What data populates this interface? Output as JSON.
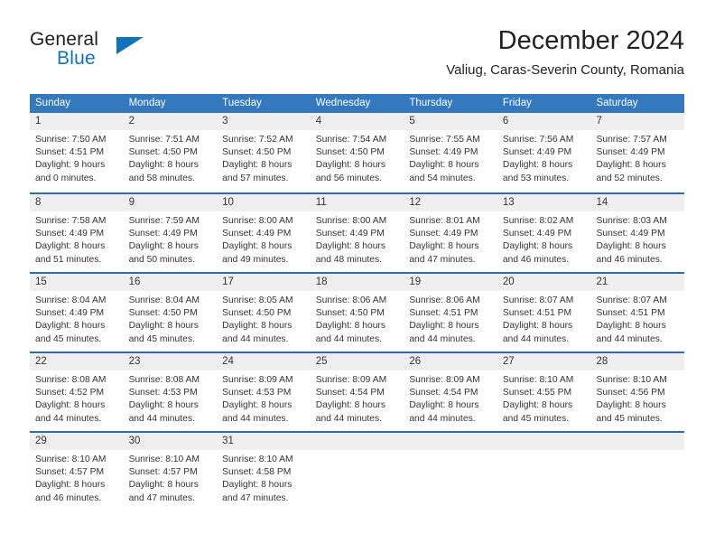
{
  "brand": {
    "name_top": "General",
    "name_bottom": "Blue",
    "accent_color": "#1272ba"
  },
  "header": {
    "title": "December 2024",
    "subtitle": "Valiug, Caras-Severin County, Romania"
  },
  "theme": {
    "header_row_bg": "#3479bd",
    "week_border": "#2a6cb0",
    "day_number_bg": "#efefef",
    "text_color": "#333333"
  },
  "weekdays": [
    "Sunday",
    "Monday",
    "Tuesday",
    "Wednesday",
    "Thursday",
    "Friday",
    "Saturday"
  ],
  "weeks": [
    [
      {
        "day": "1",
        "sunrise": "Sunrise: 7:50 AM",
        "sunset": "Sunset: 4:51 PM",
        "daylight_line1": "Daylight: 9 hours",
        "daylight_line2": "and 0 minutes."
      },
      {
        "day": "2",
        "sunrise": "Sunrise: 7:51 AM",
        "sunset": "Sunset: 4:50 PM",
        "daylight_line1": "Daylight: 8 hours",
        "daylight_line2": "and 58 minutes."
      },
      {
        "day": "3",
        "sunrise": "Sunrise: 7:52 AM",
        "sunset": "Sunset: 4:50 PM",
        "daylight_line1": "Daylight: 8 hours",
        "daylight_line2": "and 57 minutes."
      },
      {
        "day": "4",
        "sunrise": "Sunrise: 7:54 AM",
        "sunset": "Sunset: 4:50 PM",
        "daylight_line1": "Daylight: 8 hours",
        "daylight_line2": "and 56 minutes."
      },
      {
        "day": "5",
        "sunrise": "Sunrise: 7:55 AM",
        "sunset": "Sunset: 4:49 PM",
        "daylight_line1": "Daylight: 8 hours",
        "daylight_line2": "and 54 minutes."
      },
      {
        "day": "6",
        "sunrise": "Sunrise: 7:56 AM",
        "sunset": "Sunset: 4:49 PM",
        "daylight_line1": "Daylight: 8 hours",
        "daylight_line2": "and 53 minutes."
      },
      {
        "day": "7",
        "sunrise": "Sunrise: 7:57 AM",
        "sunset": "Sunset: 4:49 PM",
        "daylight_line1": "Daylight: 8 hours",
        "daylight_line2": "and 52 minutes."
      }
    ],
    [
      {
        "day": "8",
        "sunrise": "Sunrise: 7:58 AM",
        "sunset": "Sunset: 4:49 PM",
        "daylight_line1": "Daylight: 8 hours",
        "daylight_line2": "and 51 minutes."
      },
      {
        "day": "9",
        "sunrise": "Sunrise: 7:59 AM",
        "sunset": "Sunset: 4:49 PM",
        "daylight_line1": "Daylight: 8 hours",
        "daylight_line2": "and 50 minutes."
      },
      {
        "day": "10",
        "sunrise": "Sunrise: 8:00 AM",
        "sunset": "Sunset: 4:49 PM",
        "daylight_line1": "Daylight: 8 hours",
        "daylight_line2": "and 49 minutes."
      },
      {
        "day": "11",
        "sunrise": "Sunrise: 8:00 AM",
        "sunset": "Sunset: 4:49 PM",
        "daylight_line1": "Daylight: 8 hours",
        "daylight_line2": "and 48 minutes."
      },
      {
        "day": "12",
        "sunrise": "Sunrise: 8:01 AM",
        "sunset": "Sunset: 4:49 PM",
        "daylight_line1": "Daylight: 8 hours",
        "daylight_line2": "and 47 minutes."
      },
      {
        "day": "13",
        "sunrise": "Sunrise: 8:02 AM",
        "sunset": "Sunset: 4:49 PM",
        "daylight_line1": "Daylight: 8 hours",
        "daylight_line2": "and 46 minutes."
      },
      {
        "day": "14",
        "sunrise": "Sunrise: 8:03 AM",
        "sunset": "Sunset: 4:49 PM",
        "daylight_line1": "Daylight: 8 hours",
        "daylight_line2": "and 46 minutes."
      }
    ],
    [
      {
        "day": "15",
        "sunrise": "Sunrise: 8:04 AM",
        "sunset": "Sunset: 4:49 PM",
        "daylight_line1": "Daylight: 8 hours",
        "daylight_line2": "and 45 minutes."
      },
      {
        "day": "16",
        "sunrise": "Sunrise: 8:04 AM",
        "sunset": "Sunset: 4:50 PM",
        "daylight_line1": "Daylight: 8 hours",
        "daylight_line2": "and 45 minutes."
      },
      {
        "day": "17",
        "sunrise": "Sunrise: 8:05 AM",
        "sunset": "Sunset: 4:50 PM",
        "daylight_line1": "Daylight: 8 hours",
        "daylight_line2": "and 44 minutes."
      },
      {
        "day": "18",
        "sunrise": "Sunrise: 8:06 AM",
        "sunset": "Sunset: 4:50 PM",
        "daylight_line1": "Daylight: 8 hours",
        "daylight_line2": "and 44 minutes."
      },
      {
        "day": "19",
        "sunrise": "Sunrise: 8:06 AM",
        "sunset": "Sunset: 4:51 PM",
        "daylight_line1": "Daylight: 8 hours",
        "daylight_line2": "and 44 minutes."
      },
      {
        "day": "20",
        "sunrise": "Sunrise: 8:07 AM",
        "sunset": "Sunset: 4:51 PM",
        "daylight_line1": "Daylight: 8 hours",
        "daylight_line2": "and 44 minutes."
      },
      {
        "day": "21",
        "sunrise": "Sunrise: 8:07 AM",
        "sunset": "Sunset: 4:51 PM",
        "daylight_line1": "Daylight: 8 hours",
        "daylight_line2": "and 44 minutes."
      }
    ],
    [
      {
        "day": "22",
        "sunrise": "Sunrise: 8:08 AM",
        "sunset": "Sunset: 4:52 PM",
        "daylight_line1": "Daylight: 8 hours",
        "daylight_line2": "and 44 minutes."
      },
      {
        "day": "23",
        "sunrise": "Sunrise: 8:08 AM",
        "sunset": "Sunset: 4:53 PM",
        "daylight_line1": "Daylight: 8 hours",
        "daylight_line2": "and 44 minutes."
      },
      {
        "day": "24",
        "sunrise": "Sunrise: 8:09 AM",
        "sunset": "Sunset: 4:53 PM",
        "daylight_line1": "Daylight: 8 hours",
        "daylight_line2": "and 44 minutes."
      },
      {
        "day": "25",
        "sunrise": "Sunrise: 8:09 AM",
        "sunset": "Sunset: 4:54 PM",
        "daylight_line1": "Daylight: 8 hours",
        "daylight_line2": "and 44 minutes."
      },
      {
        "day": "26",
        "sunrise": "Sunrise: 8:09 AM",
        "sunset": "Sunset: 4:54 PM",
        "daylight_line1": "Daylight: 8 hours",
        "daylight_line2": "and 44 minutes."
      },
      {
        "day": "27",
        "sunrise": "Sunrise: 8:10 AM",
        "sunset": "Sunset: 4:55 PM",
        "daylight_line1": "Daylight: 8 hours",
        "daylight_line2": "and 45 minutes."
      },
      {
        "day": "28",
        "sunrise": "Sunrise: 8:10 AM",
        "sunset": "Sunset: 4:56 PM",
        "daylight_line1": "Daylight: 8 hours",
        "daylight_line2": "and 45 minutes."
      }
    ],
    [
      {
        "day": "29",
        "sunrise": "Sunrise: 8:10 AM",
        "sunset": "Sunset: 4:57 PM",
        "daylight_line1": "Daylight: 8 hours",
        "daylight_line2": "and 46 minutes."
      },
      {
        "day": "30",
        "sunrise": "Sunrise: 8:10 AM",
        "sunset": "Sunset: 4:57 PM",
        "daylight_line1": "Daylight: 8 hours",
        "daylight_line2": "and 47 minutes."
      },
      {
        "day": "31",
        "sunrise": "Sunrise: 8:10 AM",
        "sunset": "Sunset: 4:58 PM",
        "daylight_line1": "Daylight: 8 hours",
        "daylight_line2": "and 47 minutes."
      },
      {
        "day": "",
        "sunrise": "",
        "sunset": "",
        "daylight_line1": "",
        "daylight_line2": ""
      },
      {
        "day": "",
        "sunrise": "",
        "sunset": "",
        "daylight_line1": "",
        "daylight_line2": ""
      },
      {
        "day": "",
        "sunrise": "",
        "sunset": "",
        "daylight_line1": "",
        "daylight_line2": ""
      },
      {
        "day": "",
        "sunrise": "",
        "sunset": "",
        "daylight_line1": "",
        "daylight_line2": ""
      }
    ]
  ]
}
